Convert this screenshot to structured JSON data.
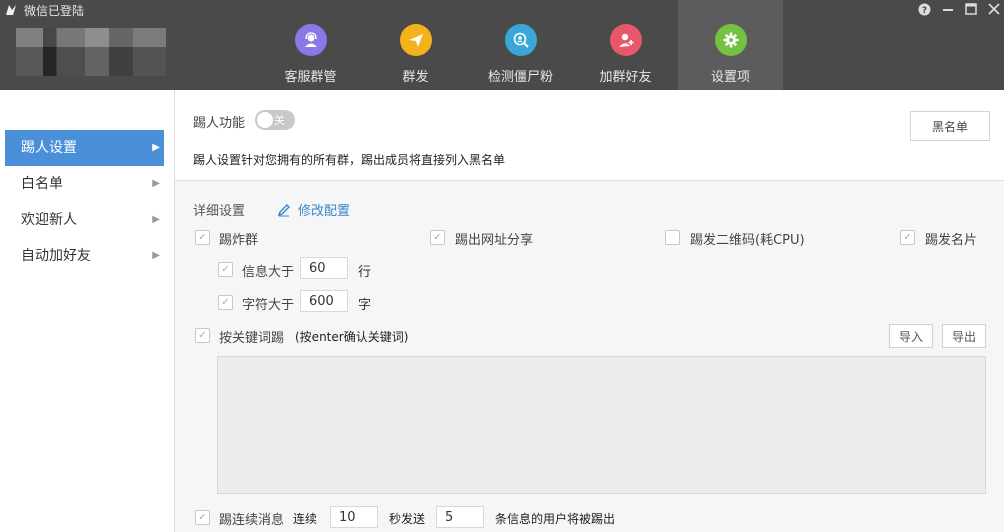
{
  "window": {
    "title": "微信已登陆"
  },
  "nav": [
    {
      "label": "客服群管",
      "icon": "customer-service-icon",
      "color": "#8a78e6"
    },
    {
      "label": "群发",
      "icon": "send-icon",
      "color": "#f2b21b"
    },
    {
      "label": "检测僵尸粉",
      "icon": "detect-icon",
      "color": "#3aa7d9"
    },
    {
      "label": "加群好友",
      "icon": "add-friend-icon",
      "color": "#e8586a"
    },
    {
      "label": "设置项",
      "icon": "gear-icon",
      "color": "#76c043"
    }
  ],
  "sidebar": [
    {
      "label": "踢人设置"
    },
    {
      "label": "白名单"
    },
    {
      "label": "欢迎新人"
    },
    {
      "label": "自动加好友"
    }
  ],
  "settings": {
    "kick_label": "踢人功能",
    "toggle_state": "关",
    "blacklist_button": "黑名单",
    "notice": "踢人设置针对您拥有的所有群，踢出成员将直接列入黑名单",
    "detail_label": "详细设置",
    "edit_config": "修改配置",
    "options": {
      "flood": "踢炸群",
      "url_share": "踢出网址分享",
      "qrcode": "踢发二维码(耗CPU)",
      "card": "踢发名片"
    },
    "msg_over": "信息大于",
    "msg_over_value": "60",
    "msg_over_unit": "行",
    "char_over": "字符大于",
    "char_over_value": "600",
    "char_over_unit": "字",
    "keyword_label": "按关键词踢",
    "keyword_hint": "(按enter确认关键词)",
    "import_button": "导入",
    "export_button": "导出",
    "consecutive_label": "踢连续消息",
    "consecutive_prefix": "连续",
    "consecutive_seconds": "10",
    "consecutive_mid": "秒发送",
    "consecutive_count": "5",
    "consecutive_suffix": "条信息的用户将被踢出"
  }
}
